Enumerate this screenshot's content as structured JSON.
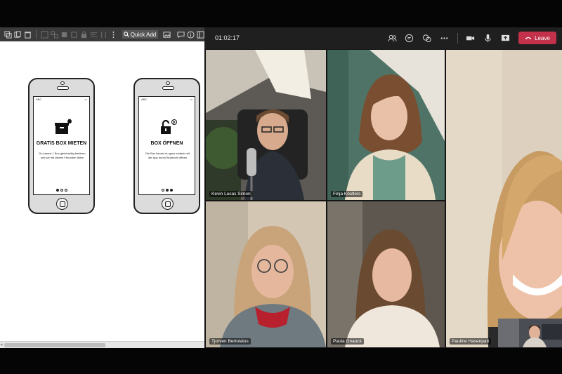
{
  "editor": {
    "quick_add_label": "Quick Add",
    "screens": [
      {
        "title": "GRATIS BOX MIETEN",
        "body": "Du kannst 1 Box gleichzeitig besitzen und sie mit deinen Freunden teilen",
        "icon": "box-icon",
        "status_carrier": "ABC",
        "active_dot": 0
      },
      {
        "title": "BOX ÖFFNEN",
        "body": "Die Box kannst du ganz einfach mit der App durch Bluetooth öffnen",
        "icon": "unlock-bluetooth-icon",
        "status_carrier": "ABC",
        "active_dot": 1
      }
    ]
  },
  "meeting": {
    "timer": "01:02:17",
    "leave_label": "Leave",
    "accent_color": "#c4314b",
    "participants": [
      {
        "name": "Kevin Lucas Simon"
      },
      {
        "name": "Finja Köstlers"
      },
      {
        "name": "Tjorven Bertolatus"
      },
      {
        "name": "Paula Gnauck"
      },
      {
        "name": "Pauline Hasenpatt"
      }
    ]
  }
}
